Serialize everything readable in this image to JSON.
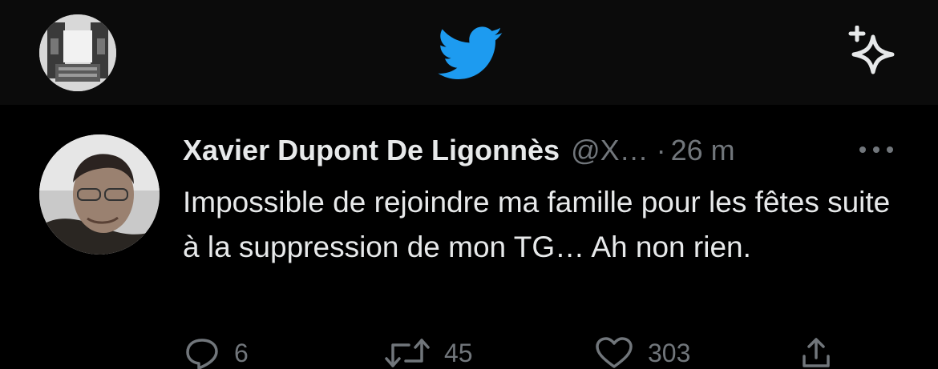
{
  "header": {
    "profile_avatar_icon": "profile-avatar",
    "logo_icon": "twitter-bird-icon",
    "sparkle_icon": "sparkle-icon",
    "accent_color": "#1d9bf0"
  },
  "tweet": {
    "author_name": "Xavier Dupont De Ligonnès",
    "handle": "@X…",
    "separator": "·",
    "time": "26 m",
    "text": "Impossible de rejoindre ma famille pour les fêtes suite à la suppression de mon TG… Ah non rien.",
    "actions": {
      "replies": "6",
      "retweets": "45",
      "likes": "303"
    }
  }
}
